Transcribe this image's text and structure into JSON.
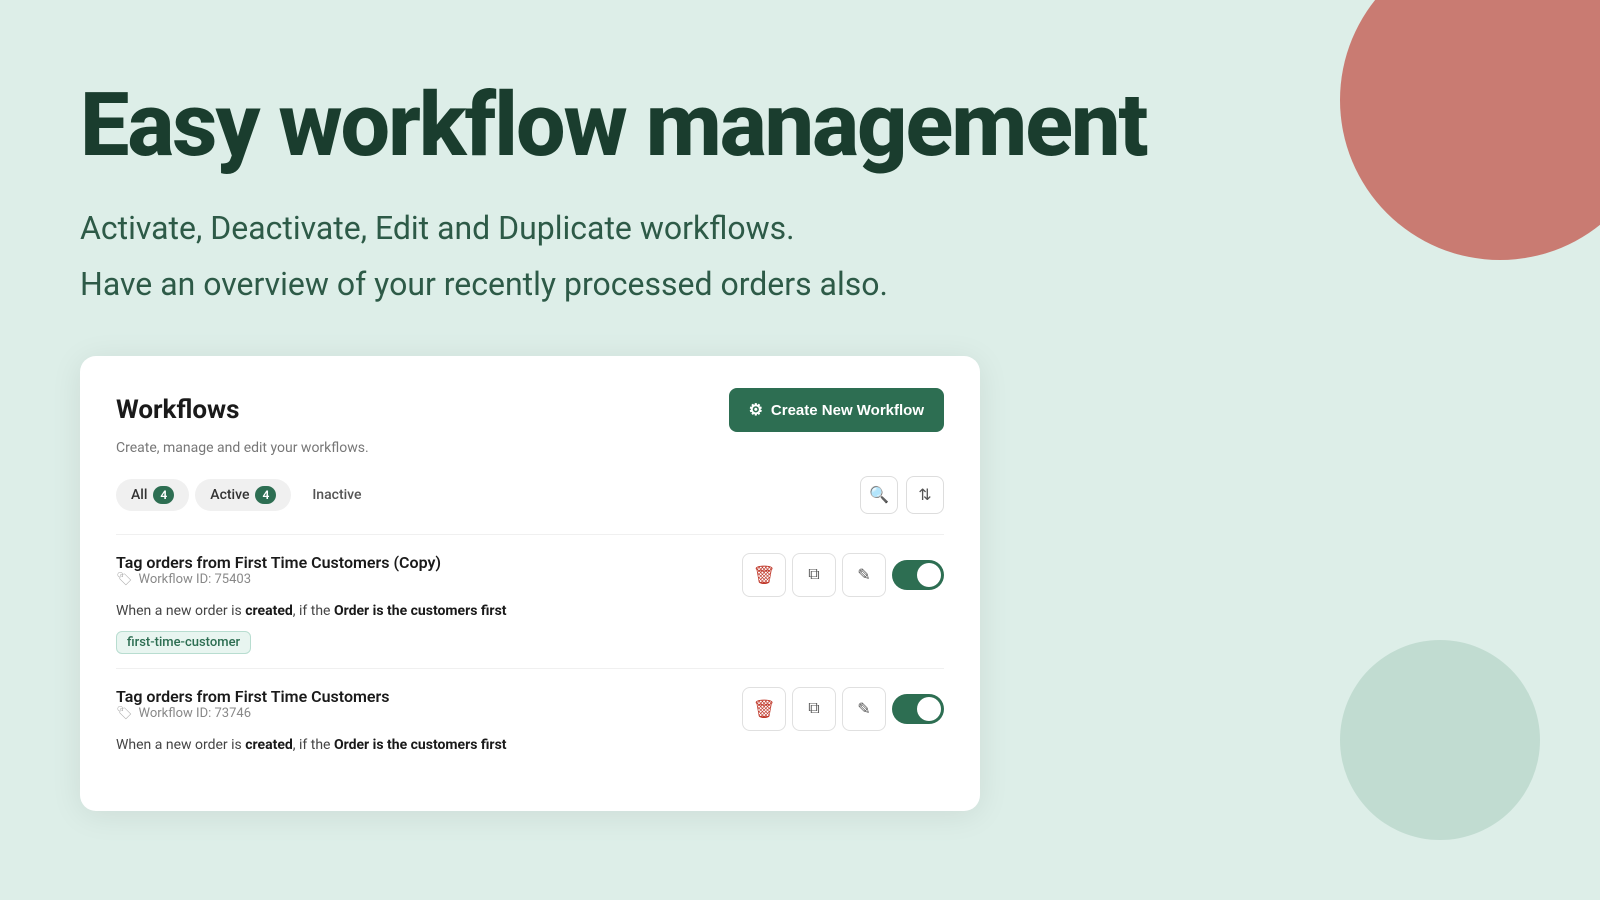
{
  "page": {
    "bg_color": "#ddeee8"
  },
  "hero": {
    "title": "Easy workflow management",
    "subtitle1": "Activate, Deactivate, Edit and Duplicate workflows.",
    "subtitle2": "Have an overview of your recently processed orders also."
  },
  "card": {
    "title": "Workflows",
    "description": "Create, manage and edit your workflows.",
    "create_btn_label": "Create New Workflow",
    "tabs": [
      {
        "label": "All",
        "count": 4,
        "id": "all"
      },
      {
        "label": "Active",
        "count": 4,
        "id": "active"
      },
      {
        "label": "Inactive",
        "count": null,
        "id": "inactive"
      }
    ],
    "workflows": [
      {
        "name": "Tag orders from First Time Customers (Copy)",
        "id": "Workflow ID: 75403",
        "description_prefix": "When a new order is ",
        "description_bold1": "created",
        "description_mid": ", if the ",
        "description_bold2": "Order is the customers first",
        "tag": "first-time-customer",
        "active": true
      },
      {
        "name": "Tag orders from First Time Customers",
        "id": "Workflow ID: 73746",
        "description_prefix": "When a new order is ",
        "description_bold1": "created",
        "description_mid": ", if the ",
        "description_bold2": "Order is the customers first",
        "tag": null,
        "active": true
      }
    ]
  },
  "icons": {
    "workflow_icon": "⚙",
    "search_icon": "🔍",
    "filter_icon": "≡",
    "sort_icon": "↕",
    "delete_icon": "🗑",
    "copy_icon": "⧉",
    "edit_icon": "✎",
    "tag_icon": "🏷"
  }
}
